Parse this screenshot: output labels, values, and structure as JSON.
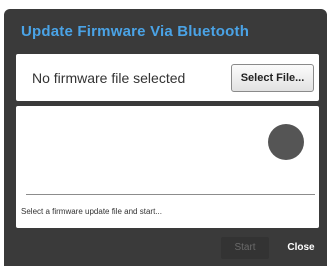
{
  "dialog": {
    "title": "Update Firmware Via Bluetooth",
    "file_status": "No firmware file selected",
    "select_file_label": "Select File...",
    "status_message": "Select a firmware update file and start...",
    "start_label": "Start",
    "close_label": "Close"
  },
  "colors": {
    "title": "#4aa3e6",
    "dialog_bg": "#3a3a3a",
    "panel_bg": "#ffffff"
  }
}
